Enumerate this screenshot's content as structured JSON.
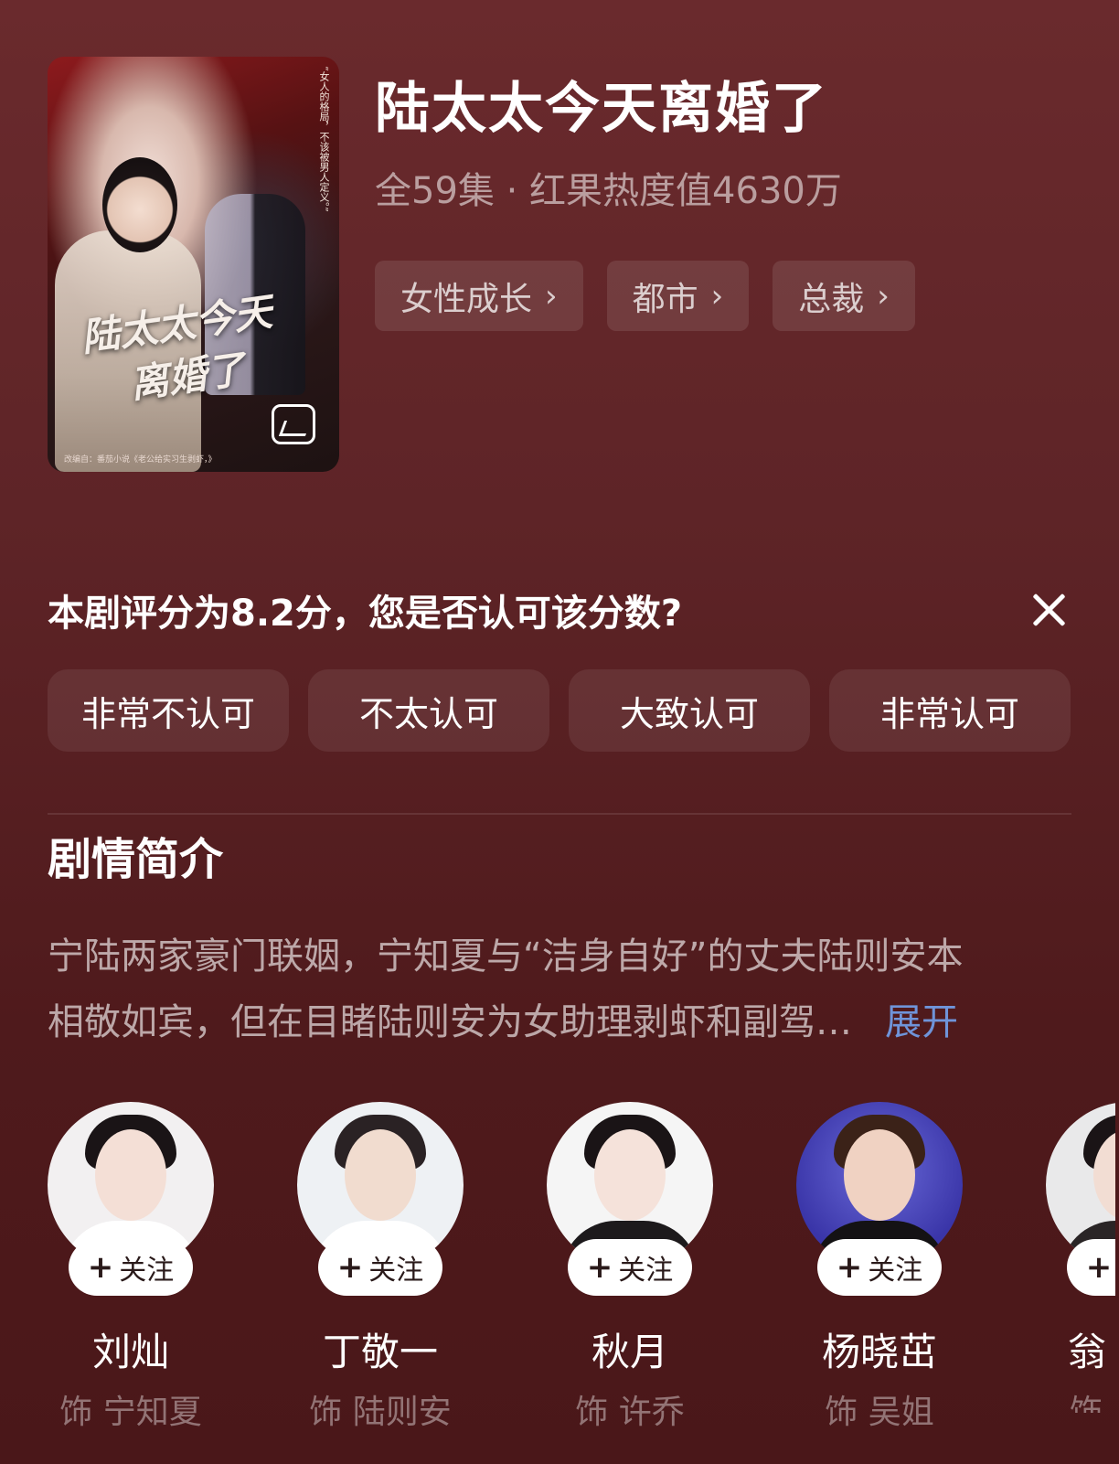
{
  "header": {
    "title": "陆太太今天离婚了",
    "meta": "全59集 · 红果热度值4630万",
    "poster": {
      "title_line1": "陆太太今天",
      "title_line2": "离婚了",
      "vertical_text": "“女人的格局，不该被男人定义。”",
      "credit": "改编自：番茄小说《老公给实习生剥虾，》"
    },
    "tags": [
      {
        "label": "女性成长"
      },
      {
        "label": "都市"
      },
      {
        "label": "总裁"
      }
    ]
  },
  "rating": {
    "question": "本剧评分为8.2分，您是否认可该分数?",
    "options": [
      "非常不认可",
      "不太认可",
      "大致认可",
      "非常认可"
    ]
  },
  "synopsis": {
    "heading": "剧情简介",
    "line1": "宁陆两家豪门联姻，宁知夏与“洁身自好”的丈夫陆则安本",
    "line2": "相敬如宾，但在目睹陆则安为女助理剥虾和副驾…",
    "expand_label": "展开"
  },
  "cast": {
    "follow_label": "关注",
    "members": [
      {
        "name": "刘灿",
        "role": "饰 宁知夏"
      },
      {
        "name": "丁敬一",
        "role": "饰 陆则安"
      },
      {
        "name": "秋月",
        "role": "饰 许乔"
      },
      {
        "name": "杨晓茁",
        "role": "饰 吴姐"
      },
      {
        "name": "翁",
        "role": "饰"
      }
    ]
  },
  "colors": {
    "background": "#5e2427",
    "link": "#6f94d9"
  },
  "icons": [
    "gallery-icon",
    "chevron-right-icon",
    "close-icon",
    "plus-icon"
  ]
}
